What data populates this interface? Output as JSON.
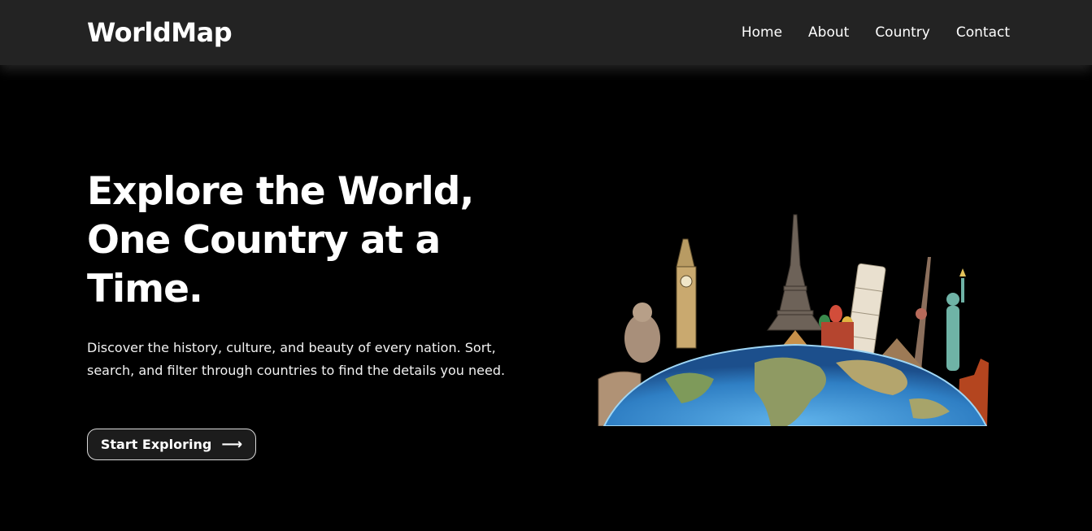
{
  "brand": {
    "logo": "WorldMap"
  },
  "nav": {
    "items": [
      {
        "label": "Home"
      },
      {
        "label": "About"
      },
      {
        "label": "Country"
      },
      {
        "label": "Contact"
      }
    ]
  },
  "hero": {
    "title": "Explore the World, One Country at a Time.",
    "description": "Discover the history, culture, and beauty of every nation. Sort, search, and filter through countries to find the details you need.",
    "cta_label": "Start Exploring",
    "cta_icon": "arrow-right-icon",
    "image_icon": "world-landmarks-globe"
  },
  "colors": {
    "background": "#000000",
    "navbar": "#232323",
    "text": "#ffffff",
    "ocean": "#2f7fc4",
    "land": "#8a8f5a"
  }
}
